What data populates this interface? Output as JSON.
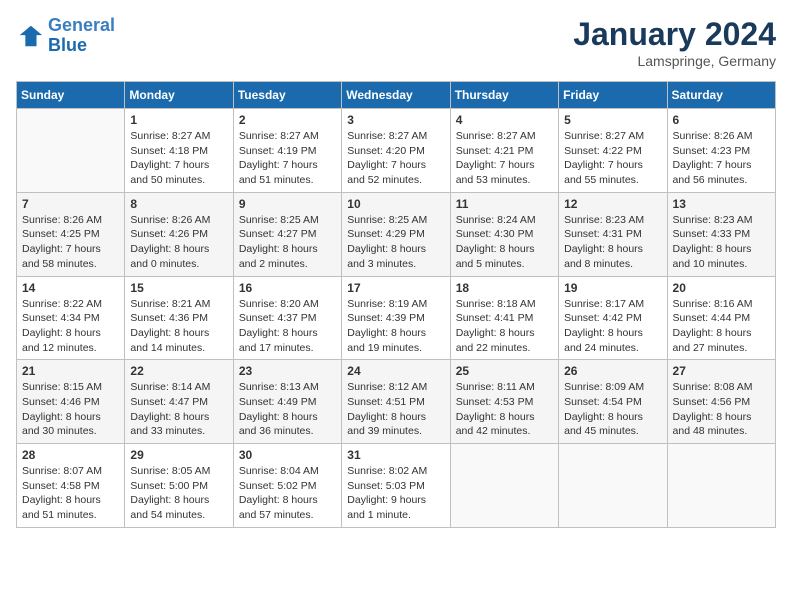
{
  "logo": {
    "line1": "General",
    "line2": "Blue"
  },
  "title": "January 2024",
  "subtitle": "Lamspringe, Germany",
  "days_header": [
    "Sunday",
    "Monday",
    "Tuesday",
    "Wednesday",
    "Thursday",
    "Friday",
    "Saturday"
  ],
  "weeks": [
    [
      {
        "num": "",
        "sunrise": "",
        "sunset": "",
        "daylight": ""
      },
      {
        "num": "1",
        "sunrise": "Sunrise: 8:27 AM",
        "sunset": "Sunset: 4:18 PM",
        "daylight": "Daylight: 7 hours and 50 minutes."
      },
      {
        "num": "2",
        "sunrise": "Sunrise: 8:27 AM",
        "sunset": "Sunset: 4:19 PM",
        "daylight": "Daylight: 7 hours and 51 minutes."
      },
      {
        "num": "3",
        "sunrise": "Sunrise: 8:27 AM",
        "sunset": "Sunset: 4:20 PM",
        "daylight": "Daylight: 7 hours and 52 minutes."
      },
      {
        "num": "4",
        "sunrise": "Sunrise: 8:27 AM",
        "sunset": "Sunset: 4:21 PM",
        "daylight": "Daylight: 7 hours and 53 minutes."
      },
      {
        "num": "5",
        "sunrise": "Sunrise: 8:27 AM",
        "sunset": "Sunset: 4:22 PM",
        "daylight": "Daylight: 7 hours and 55 minutes."
      },
      {
        "num": "6",
        "sunrise": "Sunrise: 8:26 AM",
        "sunset": "Sunset: 4:23 PM",
        "daylight": "Daylight: 7 hours and 56 minutes."
      }
    ],
    [
      {
        "num": "7",
        "sunrise": "Sunrise: 8:26 AM",
        "sunset": "Sunset: 4:25 PM",
        "daylight": "Daylight: 7 hours and 58 minutes."
      },
      {
        "num": "8",
        "sunrise": "Sunrise: 8:26 AM",
        "sunset": "Sunset: 4:26 PM",
        "daylight": "Daylight: 8 hours and 0 minutes."
      },
      {
        "num": "9",
        "sunrise": "Sunrise: 8:25 AM",
        "sunset": "Sunset: 4:27 PM",
        "daylight": "Daylight: 8 hours and 2 minutes."
      },
      {
        "num": "10",
        "sunrise": "Sunrise: 8:25 AM",
        "sunset": "Sunset: 4:29 PM",
        "daylight": "Daylight: 8 hours and 3 minutes."
      },
      {
        "num": "11",
        "sunrise": "Sunrise: 8:24 AM",
        "sunset": "Sunset: 4:30 PM",
        "daylight": "Daylight: 8 hours and 5 minutes."
      },
      {
        "num": "12",
        "sunrise": "Sunrise: 8:23 AM",
        "sunset": "Sunset: 4:31 PM",
        "daylight": "Daylight: 8 hours and 8 minutes."
      },
      {
        "num": "13",
        "sunrise": "Sunrise: 8:23 AM",
        "sunset": "Sunset: 4:33 PM",
        "daylight": "Daylight: 8 hours and 10 minutes."
      }
    ],
    [
      {
        "num": "14",
        "sunrise": "Sunrise: 8:22 AM",
        "sunset": "Sunset: 4:34 PM",
        "daylight": "Daylight: 8 hours and 12 minutes."
      },
      {
        "num": "15",
        "sunrise": "Sunrise: 8:21 AM",
        "sunset": "Sunset: 4:36 PM",
        "daylight": "Daylight: 8 hours and 14 minutes."
      },
      {
        "num": "16",
        "sunrise": "Sunrise: 8:20 AM",
        "sunset": "Sunset: 4:37 PM",
        "daylight": "Daylight: 8 hours and 17 minutes."
      },
      {
        "num": "17",
        "sunrise": "Sunrise: 8:19 AM",
        "sunset": "Sunset: 4:39 PM",
        "daylight": "Daylight: 8 hours and 19 minutes."
      },
      {
        "num": "18",
        "sunrise": "Sunrise: 8:18 AM",
        "sunset": "Sunset: 4:41 PM",
        "daylight": "Daylight: 8 hours and 22 minutes."
      },
      {
        "num": "19",
        "sunrise": "Sunrise: 8:17 AM",
        "sunset": "Sunset: 4:42 PM",
        "daylight": "Daylight: 8 hours and 24 minutes."
      },
      {
        "num": "20",
        "sunrise": "Sunrise: 8:16 AM",
        "sunset": "Sunset: 4:44 PM",
        "daylight": "Daylight: 8 hours and 27 minutes."
      }
    ],
    [
      {
        "num": "21",
        "sunrise": "Sunrise: 8:15 AM",
        "sunset": "Sunset: 4:46 PM",
        "daylight": "Daylight: 8 hours and 30 minutes."
      },
      {
        "num": "22",
        "sunrise": "Sunrise: 8:14 AM",
        "sunset": "Sunset: 4:47 PM",
        "daylight": "Daylight: 8 hours and 33 minutes."
      },
      {
        "num": "23",
        "sunrise": "Sunrise: 8:13 AM",
        "sunset": "Sunset: 4:49 PM",
        "daylight": "Daylight: 8 hours and 36 minutes."
      },
      {
        "num": "24",
        "sunrise": "Sunrise: 8:12 AM",
        "sunset": "Sunset: 4:51 PM",
        "daylight": "Daylight: 8 hours and 39 minutes."
      },
      {
        "num": "25",
        "sunrise": "Sunrise: 8:11 AM",
        "sunset": "Sunset: 4:53 PM",
        "daylight": "Daylight: 8 hours and 42 minutes."
      },
      {
        "num": "26",
        "sunrise": "Sunrise: 8:09 AM",
        "sunset": "Sunset: 4:54 PM",
        "daylight": "Daylight: 8 hours and 45 minutes."
      },
      {
        "num": "27",
        "sunrise": "Sunrise: 8:08 AM",
        "sunset": "Sunset: 4:56 PM",
        "daylight": "Daylight: 8 hours and 48 minutes."
      }
    ],
    [
      {
        "num": "28",
        "sunrise": "Sunrise: 8:07 AM",
        "sunset": "Sunset: 4:58 PM",
        "daylight": "Daylight: 8 hours and 51 minutes."
      },
      {
        "num": "29",
        "sunrise": "Sunrise: 8:05 AM",
        "sunset": "Sunset: 5:00 PM",
        "daylight": "Daylight: 8 hours and 54 minutes."
      },
      {
        "num": "30",
        "sunrise": "Sunrise: 8:04 AM",
        "sunset": "Sunset: 5:02 PM",
        "daylight": "Daylight: 8 hours and 57 minutes."
      },
      {
        "num": "31",
        "sunrise": "Sunrise: 8:02 AM",
        "sunset": "Sunset: 5:03 PM",
        "daylight": "Daylight: 9 hours and 1 minute."
      },
      {
        "num": "",
        "sunrise": "",
        "sunset": "",
        "daylight": ""
      },
      {
        "num": "",
        "sunrise": "",
        "sunset": "",
        "daylight": ""
      },
      {
        "num": "",
        "sunrise": "",
        "sunset": "",
        "daylight": ""
      }
    ]
  ]
}
